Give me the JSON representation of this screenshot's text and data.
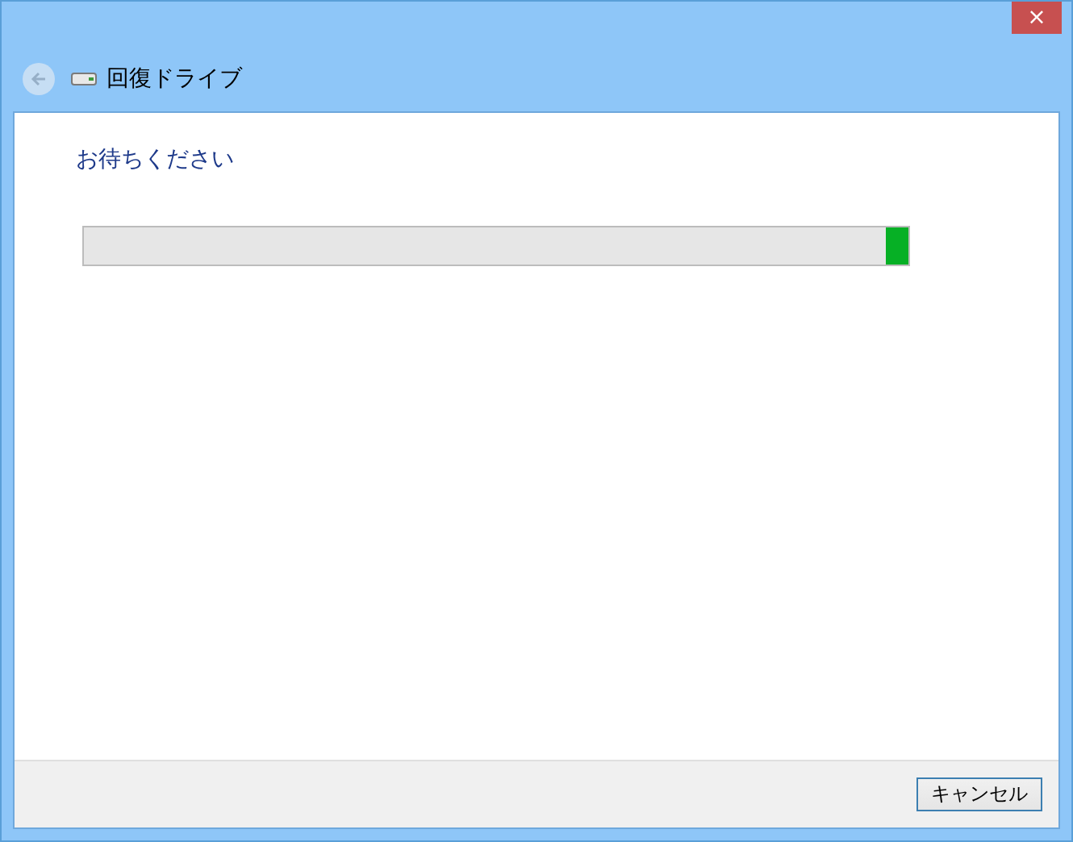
{
  "window": {
    "close_button": "×"
  },
  "nav": {
    "back_button": {
      "disabled": true
    },
    "title": "回復ドライブ"
  },
  "content": {
    "heading": "お待ちください",
    "progress": {
      "kind": "marquee"
    }
  },
  "footer": {
    "buttons": [
      "キャンセル"
    ]
  }
}
